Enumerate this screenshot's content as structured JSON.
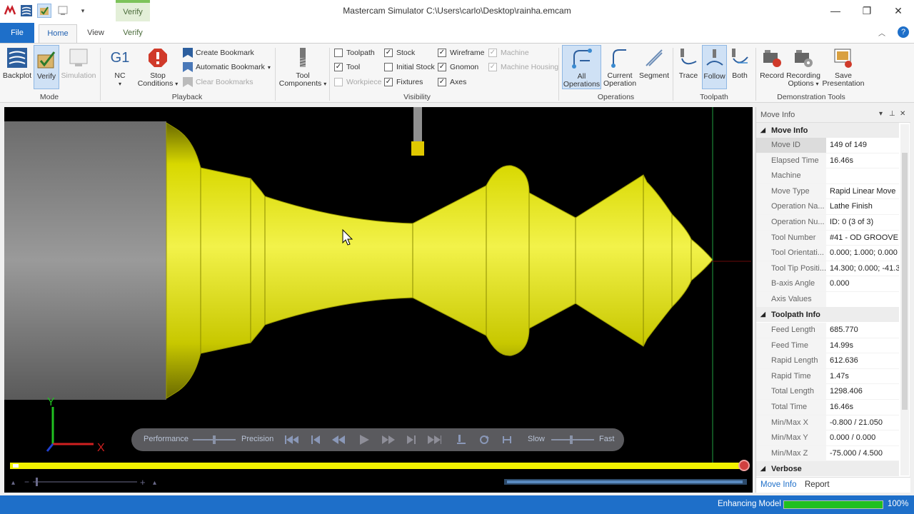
{
  "window": {
    "title": "Mastercam Simulator  C:\\Users\\carlo\\Desktop\\rainha.emcam",
    "context_tab": "Verify",
    "minimize_glyph": "—",
    "restore_glyph": "❐",
    "close_glyph": "✕"
  },
  "tabs": {
    "file": "File",
    "home": "Home",
    "view": "View",
    "verify": "Verify"
  },
  "ribbon": {
    "mode": {
      "label": "Mode",
      "backplot": "Backplot",
      "verify": "Verify",
      "simulation": "Simulation"
    },
    "playback": {
      "label": "Playback",
      "nc": "NC",
      "nc_icon_text": "G1",
      "stop_conditions": "Stop Conditions",
      "create_bookmark": "Create Bookmark",
      "automatic_bookmark": "Automatic Bookmark",
      "clear_bookmarks": "Clear Bookmarks"
    },
    "tool_components": "Tool Components",
    "visibility": {
      "label": "Visibility",
      "items": [
        {
          "label": "Toolpath",
          "checked": false,
          "enabled": true
        },
        {
          "label": "Tool",
          "checked": true,
          "enabled": true
        },
        {
          "label": "Workpiece",
          "checked": false,
          "enabled": false
        },
        {
          "label": "Stock",
          "checked": true,
          "enabled": true
        },
        {
          "label": "Initial Stock",
          "checked": false,
          "enabled": true
        },
        {
          "label": "Fixtures",
          "checked": true,
          "enabled": true
        },
        {
          "label": "Wireframe",
          "checked": true,
          "enabled": true
        },
        {
          "label": "Gnomon",
          "checked": true,
          "enabled": true
        },
        {
          "label": "Axes",
          "checked": true,
          "enabled": true
        },
        {
          "label": "Machine",
          "checked": true,
          "enabled": false
        },
        {
          "label": "Machine Housing",
          "checked": true,
          "enabled": false
        }
      ]
    },
    "operations": {
      "label": "Operations",
      "all": "All Operations",
      "current": "Current Operation",
      "segment": "Segment"
    },
    "toolpath": {
      "label": "Toolpath",
      "trace": "Trace",
      "follow": "Follow",
      "both": "Both"
    },
    "demo": {
      "label": "Demonstration Tools",
      "record": "Record",
      "recording_options": "Recording Options",
      "save_presentation": "Save Presentation"
    }
  },
  "viewport": {
    "gnomon": {
      "x": "X",
      "y": "Y"
    },
    "speedbar": {
      "performance": "Performance",
      "precision": "Precision",
      "slow": "Slow",
      "fast": "Fast"
    },
    "progress": 1.0,
    "colors": {
      "stock": "#e8e800",
      "chuck": "#8a8a8a",
      "background": "#000000",
      "progress": "#f2f200"
    }
  },
  "panel": {
    "title": "Move Info",
    "move_info_section": "Move Info",
    "move_info": [
      {
        "key": "Move ID",
        "value": "149 of 149"
      },
      {
        "key": "Elapsed Time",
        "value": "16.46s"
      },
      {
        "key": "Machine",
        "value": ""
      },
      {
        "key": "Move Type",
        "value": "Rapid Linear Move"
      },
      {
        "key": "Operation Na...",
        "value": "Lathe Finish"
      },
      {
        "key": "Operation Nu...",
        "value": "ID: 0 (3 of 3)"
      },
      {
        "key": "Tool Number",
        "value": "#41 - OD GROOVE"
      },
      {
        "key": "Tool Orientati...",
        "value": "0.000; 1.000; 0.000"
      },
      {
        "key": "Tool Tip Positi...",
        "value": "14.300; 0.000; -41.3"
      },
      {
        "key": "B-axis Angle",
        "value": "0.000"
      },
      {
        "key": "Axis Values",
        "value": ""
      }
    ],
    "toolpath_info_section": "Toolpath Info",
    "toolpath_info": [
      {
        "key": "Feed Length",
        "value": "685.770"
      },
      {
        "key": "Feed Time",
        "value": "14.99s"
      },
      {
        "key": "Rapid Length",
        "value": "612.636"
      },
      {
        "key": "Rapid Time",
        "value": "1.47s"
      },
      {
        "key": "Total Length",
        "value": "1298.406"
      },
      {
        "key": "Total Time",
        "value": "16.46s"
      },
      {
        "key": "Min/Max X",
        "value": "-0.800 / 21.050"
      },
      {
        "key": "Min/Max Y",
        "value": "0.000 / 0.000"
      },
      {
        "key": "Min/Max Z",
        "value": "-75.000 / 4.500"
      }
    ],
    "verbose_section": "Verbose",
    "tabs": {
      "move_info": "Move Info",
      "report": "Report"
    }
  },
  "status": {
    "text": "Enhancing Model",
    "percent_label": "100%",
    "progress": 1.0
  }
}
